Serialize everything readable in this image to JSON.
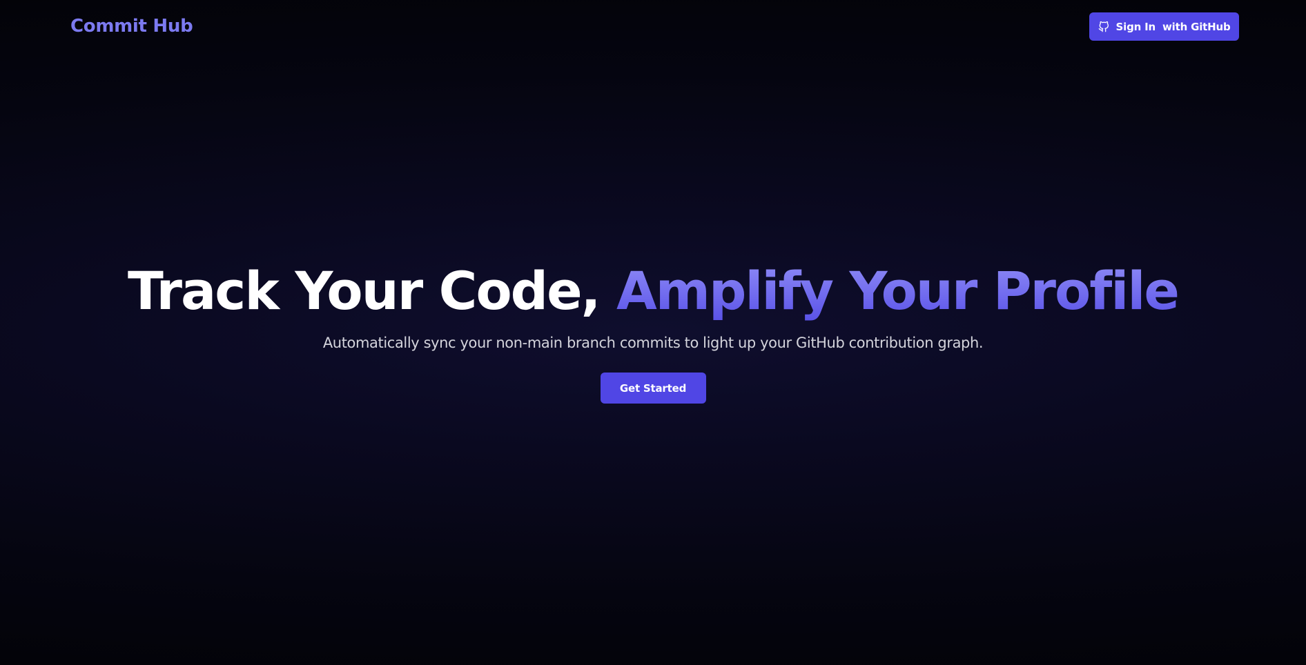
{
  "header": {
    "brand": "Commit Hub",
    "signin": {
      "icon": "github-icon",
      "label": "Sign In  with GitHub"
    }
  },
  "hero": {
    "headline_plain": "Track Your Code, ",
    "headline_accent": "Amplify Your Profile",
    "subtitle": "Automatically sync your non-main branch commits to light up your GitHub contribution graph.",
    "cta_label": "Get Started"
  },
  "colors": {
    "accent": "#5046e5",
    "brand_text": "#7c7af0",
    "background": "#050510"
  }
}
